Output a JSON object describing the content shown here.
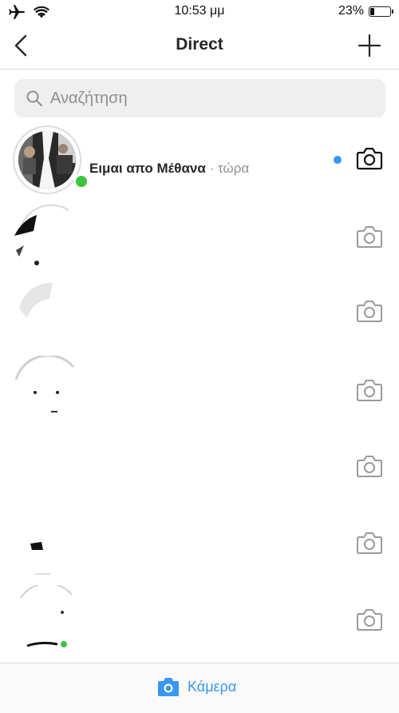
{
  "status_bar": {
    "time": "10:53 μμ",
    "battery_percent": "23%",
    "battery_level": 0.23
  },
  "nav": {
    "title": "Direct",
    "back_icon": "chevron-left-icon",
    "new_icon": "plus-icon"
  },
  "search": {
    "placeholder": "Αναζήτηση"
  },
  "threads": [
    {
      "name": "Ειμαι απο Μέθανα",
      "separator": " · ",
      "time": "τώρα",
      "online": true,
      "unread": true
    }
  ],
  "bottom_bar": {
    "camera_label": "Κάμερα"
  },
  "colors": {
    "accent": "#3897f0",
    "online": "#3ec43e",
    "separator": "#dbdbdb",
    "secondary_text": "#8e8e8e"
  }
}
